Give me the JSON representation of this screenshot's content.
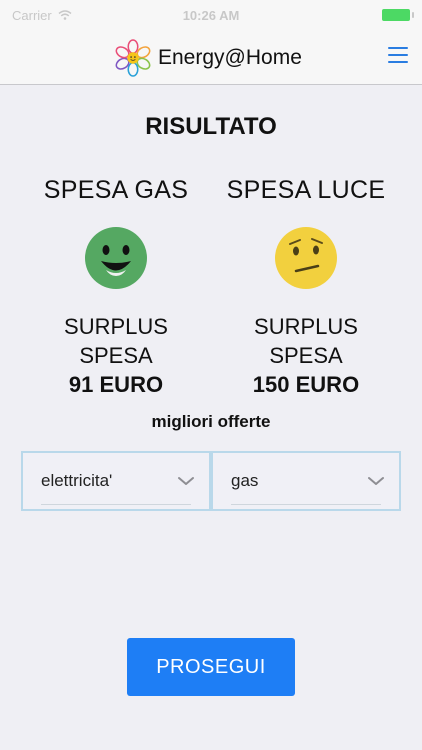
{
  "status_bar": {
    "carrier": "Carrier",
    "time": "10:26 AM"
  },
  "nav": {
    "title": "Energy@Home",
    "icons": [
      "flower-logo-icon",
      "hamburger-menu-icon"
    ],
    "accent": "#2a7de1"
  },
  "main": {
    "title": "RISULTATO",
    "gas": {
      "heading": "SPESA GAS",
      "face": "happy-face-icon",
      "face_color": "#55a862",
      "surplus_line1": "SURPLUS",
      "surplus_line2": "SPESA",
      "amount": "91 EURO"
    },
    "luce": {
      "heading": "SPESA LUCE",
      "face": "confused-face-icon",
      "face_color": "#f2d03e",
      "surplus_line1": "SURPLUS",
      "surplus_line2": "SPESA",
      "amount": "150 EURO"
    },
    "offers_label": "migliori offerte",
    "selects": [
      {
        "value": "elettricita'"
      },
      {
        "value": "gas"
      }
    ],
    "proceed_label": "PROSEGUI",
    "button_color": "#1e7ef5"
  }
}
